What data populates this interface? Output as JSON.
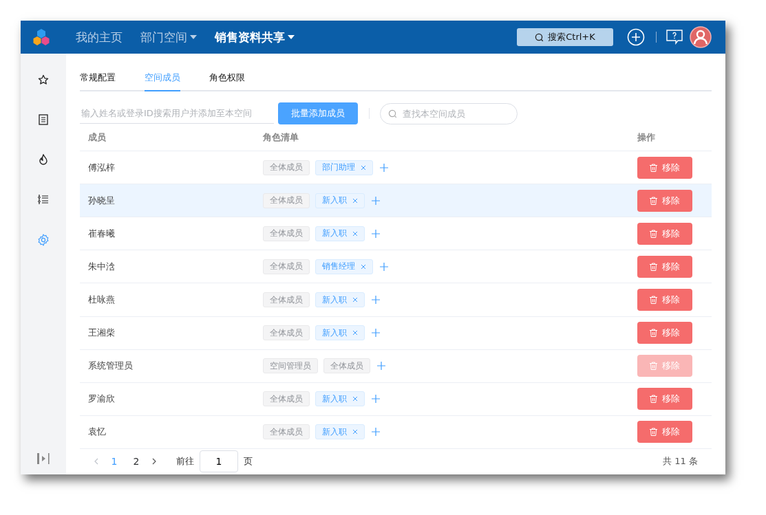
{
  "topbar": {
    "nav": [
      {
        "label": "我的主页",
        "selected": false,
        "dropdown": false
      },
      {
        "label": "部门空间",
        "selected": false,
        "dropdown": true
      },
      {
        "label": "销售资料共享",
        "selected": true,
        "dropdown": true
      }
    ],
    "search": {
      "label": "搜索Ctrl+K"
    }
  },
  "sidebar": {
    "items": [
      {
        "selected": false
      },
      {
        "selected": false
      },
      {
        "selected": false
      },
      {
        "selected": false
      },
      {
        "selected": true
      }
    ]
  },
  "tabs": [
    {
      "label": "常规配置",
      "selected": false
    },
    {
      "label": "空间成员",
      "selected": true
    },
    {
      "label": "角色权限",
      "selected": false
    }
  ],
  "toolbar": {
    "add_placeholder": "输入姓名或登录ID搜索用户并添加至本空间",
    "batch_button": "批量添加成员",
    "search_placeholder": "查找本空间成员"
  },
  "table": {
    "columns": [
      "成员",
      "角色清单",
      "操作"
    ],
    "rows": [
      {
        "name": "傅泓梓",
        "selected": false,
        "roles": [
          {
            "label": "全体成员",
            "kind": "fixed"
          },
          {
            "label": "部门助理",
            "kind": "removable"
          }
        ],
        "action": "移除",
        "disabled": false
      },
      {
        "name": "孙晓呈",
        "selected": true,
        "roles": [
          {
            "label": "全体成员",
            "kind": "fixed"
          },
          {
            "label": "新入职",
            "kind": "removable"
          }
        ],
        "action": "移除",
        "disabled": false
      },
      {
        "name": "崔春曦",
        "selected": false,
        "roles": [
          {
            "label": "全体成员",
            "kind": "fixed"
          },
          {
            "label": "新入职",
            "kind": "removable"
          }
        ],
        "action": "移除",
        "disabled": false
      },
      {
        "name": "朱中浛",
        "selected": false,
        "roles": [
          {
            "label": "全体成员",
            "kind": "fixed"
          },
          {
            "label": "销售经理",
            "kind": "removable"
          }
        ],
        "action": "移除",
        "disabled": false
      },
      {
        "name": "杜咏燕",
        "selected": false,
        "roles": [
          {
            "label": "全体成员",
            "kind": "fixed"
          },
          {
            "label": "新入职",
            "kind": "removable"
          }
        ],
        "action": "移除",
        "disabled": false
      },
      {
        "name": "王湘柴",
        "selected": false,
        "roles": [
          {
            "label": "全体成员",
            "kind": "fixed"
          },
          {
            "label": "新入职",
            "kind": "removable"
          }
        ],
        "action": "移除",
        "disabled": false
      },
      {
        "name": "系统管理员",
        "selected": false,
        "roles": [
          {
            "label": "空间管理员",
            "kind": "fixed"
          },
          {
            "label": "全体成员",
            "kind": "fixed"
          }
        ],
        "action": "移除",
        "disabled": true
      },
      {
        "name": "罗渝欣",
        "selected": false,
        "roles": [
          {
            "label": "全体成员",
            "kind": "fixed"
          },
          {
            "label": "新入职",
            "kind": "removable"
          }
        ],
        "action": "移除",
        "disabled": false
      },
      {
        "name": "袁忆",
        "selected": false,
        "roles": [
          {
            "label": "全体成员",
            "kind": "fixed"
          },
          {
            "label": "新入职",
            "kind": "removable"
          }
        ],
        "action": "移除",
        "disabled": false
      }
    ]
  },
  "pagination": {
    "pages": [
      {
        "label": "1",
        "selected": true
      },
      {
        "label": "2",
        "selected": false
      }
    ],
    "goto_label": "前往",
    "page_value": "1",
    "page_suffix": "页",
    "total": "共 11 条"
  }
}
